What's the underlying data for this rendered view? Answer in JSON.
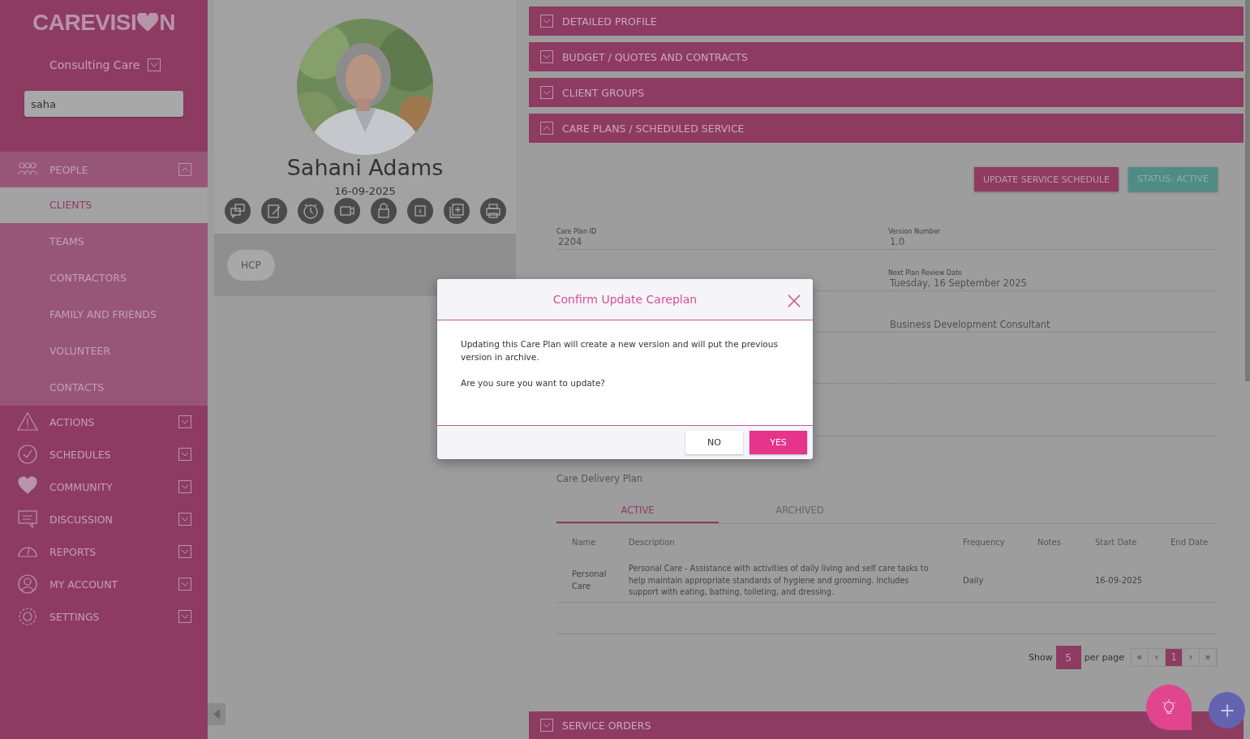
{
  "sidebar": {
    "logo": {
      "before": "CAREVISI",
      "after": "N"
    },
    "organisation": "Consulting Care",
    "search": {
      "value": "saha"
    },
    "nav": [
      {
        "label": "PEOPLE",
        "selected": true,
        "expanded": true,
        "children": [
          {
            "label": "CLIENTS",
            "selected": true
          },
          {
            "label": "TEAMS",
            "selected": false
          },
          {
            "label": "CONTRACTORS",
            "selected": false
          },
          {
            "label": "FAMILY AND FRIENDS",
            "selected": false
          },
          {
            "label": "VOLUNTEER",
            "selected": false
          },
          {
            "label": "CONTACTS",
            "selected": false
          }
        ]
      },
      {
        "label": "ACTIONS",
        "selected": false,
        "expanded": false
      },
      {
        "label": "SCHEDULES",
        "selected": false,
        "expanded": false
      },
      {
        "label": "COMMUNITY",
        "selected": false,
        "expanded": false
      },
      {
        "label": "DISCUSSION",
        "selected": false,
        "expanded": false
      },
      {
        "label": "REPORTS",
        "selected": false,
        "expanded": false
      },
      {
        "label": "MY ACCOUNT",
        "selected": false,
        "expanded": false
      },
      {
        "label": "SETTINGS",
        "selected": false,
        "expanded": false
      }
    ]
  },
  "profile": {
    "photo": {
      "kind": "picture"
    },
    "name": "Sahani Adams",
    "date": "16-09-2025",
    "tags": [
      "HCP"
    ]
  },
  "sections": [
    {
      "title": "DETAILED PROFILE",
      "expanded": false
    },
    {
      "title": "BUDGET / QUOTES AND CONTRACTS",
      "expanded": false
    },
    {
      "title": "CLIENT GROUPS",
      "expanded": false
    },
    {
      "title": "CARE PLANS / SCHEDULED SERVICE",
      "expanded": true
    }
  ],
  "care_plan": {
    "update_button": "UPDATE SERVICE SCHEDULE",
    "status": "STATUS: ACTIVE",
    "fields": [
      {
        "label": "Care Plan ID",
        "value": "2204"
      },
      {
        "label": "Version Number",
        "value": "1.0"
      },
      {
        "label": "Next Plan Review Date",
        "value": "Tuesday, 16 September 2025"
      },
      {
        "value": "Business Development Consultant"
      }
    ],
    "delivery_title": "Care Delivery Plan",
    "tabs": [
      {
        "label": "ACTIVE",
        "selected": true
      },
      {
        "label": "ARCHIVED",
        "selected": false
      }
    ],
    "table": {
      "columns": [
        "Name",
        "Description",
        "Frequency",
        "Notes",
        "Start Date",
        "End Date"
      ],
      "rows": [
        [
          "Personal Care",
          "Personal Care - Assistance with activities of daily living and self care tasks to help maintain appropriate standards of hygiene and grooming. Includes support with eating, bathing, toileting, and dressing.",
          "Daily",
          "",
          "16-09-2025",
          ""
        ]
      ]
    },
    "pagination": {
      "show": "Show",
      "page_size": "5",
      "per_page": "per page",
      "pages": [
        {
          "label": "«",
          "selected": false
        },
        {
          "label": "‹",
          "selected": false
        },
        {
          "label": "1",
          "selected": true
        },
        {
          "label": "›",
          "selected": false
        },
        {
          "label": "»",
          "selected": false
        }
      ]
    }
  },
  "bottom_section": {
    "title": "SERVICE ORDERS",
    "expanded": false
  },
  "dialog": {
    "title": "Confirm Update Careplan",
    "message": "Updating this Care Plan will create a new version and will put the previous version in archive.",
    "question": "Are you sure you want to update?",
    "buttons": [
      {
        "label": "NO",
        "kind": "secondary"
      },
      {
        "label": "YES",
        "kind": "primary"
      }
    ]
  }
}
